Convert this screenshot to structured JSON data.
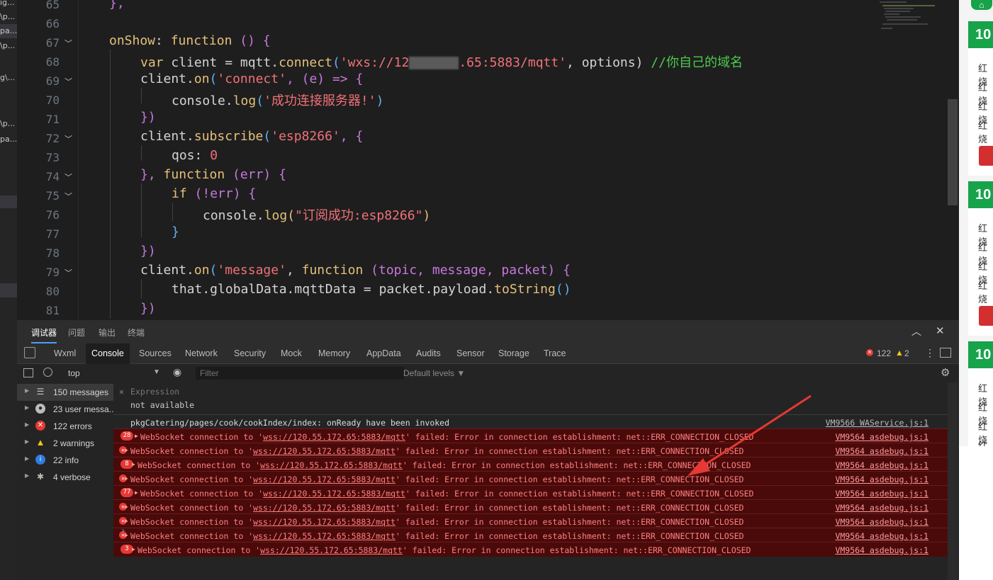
{
  "file_tree": {
    "items": [
      "ig...",
      "\\p...",
      "pa...",
      "\\p...",
      "g\\...",
      "\\p...",
      "pa..."
    ]
  },
  "editor": {
    "lines": [
      {
        "num": "65",
        "html_key": "l65"
      },
      {
        "num": "66"
      },
      {
        "num": "67"
      },
      {
        "num": "68"
      },
      {
        "num": "69"
      },
      {
        "num": "70"
      },
      {
        "num": "71"
      },
      {
        "num": "72"
      },
      {
        "num": "73"
      },
      {
        "num": "74"
      },
      {
        "num": "75"
      },
      {
        "num": "76"
      },
      {
        "num": "77"
      },
      {
        "num": "78"
      },
      {
        "num": "79"
      },
      {
        "num": "80"
      },
      {
        "num": "81"
      }
    ],
    "code": {
      "l65": "},",
      "l67_a": "onShow",
      "l67_b": ": ",
      "l67_c": "function",
      "l67_d": " () {",
      "l68_a": "var",
      "l68_b": " client = mqtt.",
      "l68_c": "connect",
      "l68_d": "(",
      "l68_e": "'wxs://12",
      "l68_f": ".65:5883/mqtt'",
      "l68_g": ", options) ",
      "l68_h": "//你自己的域名",
      "l69_a": "client.",
      "l69_b": "on",
      "l69_c": "(",
      "l69_d": "'connect'",
      "l69_e": ", (e) => {",
      "l70_a": "console.",
      "l70_b": "log",
      "l70_c": "(",
      "l70_d": "'成功连接服务器!'",
      "l70_e": ")",
      "l71": "})",
      "l72_a": "client.",
      "l72_b": "subscribe",
      "l72_c": "(",
      "l72_d": "'esp8266'",
      "l72_e": ", {",
      "l73_a": "qos: ",
      "l73_b": "0",
      "l74_a": "}, ",
      "l74_b": "function",
      "l74_c": " (err) {",
      "l75_a": "if",
      "l75_b": " (!err) {",
      "l76_a": "console.",
      "l76_b": "log",
      "l76_c": "(",
      "l76_d": "\"订阅成功:esp8266\"",
      "l76_e": ")",
      "l77": "}",
      "l78": "})",
      "l79_a": "client.",
      "l79_b": "on",
      "l79_c": "(",
      "l79_d": "'message'",
      "l79_e": ", ",
      "l79_f": "function",
      "l79_g": " (topic, message, packet) {",
      "l80_a": "that.globalData.mqttData = packet.payload.",
      "l80_b": "toString",
      "l80_c": "()",
      "l81": "})"
    }
  },
  "preview": {
    "home_icon": "home-icon",
    "cards": [
      {
        "head": "10",
        "rows": [
          "红烧",
          "红烧",
          "红烧",
          "红烧"
        ]
      },
      {
        "head": "10",
        "rows": [
          "红烧",
          "红烧",
          "红烧",
          "红烧"
        ]
      },
      {
        "head": "10",
        "rows": [
          "红烧",
          "红烧",
          "红烧",
          "红烧"
        ]
      }
    ]
  },
  "devtools": {
    "top_tabs": [
      "调试器",
      "问题",
      "输出",
      "终端"
    ],
    "tabs": [
      "Wxml",
      "Console",
      "Sources",
      "Network",
      "Security",
      "Mock",
      "Memory",
      "AppData",
      "Audits",
      "Sensor",
      "Storage",
      "Trace"
    ],
    "error_count": "122",
    "warning_count": "2",
    "context": "top",
    "filter_placeholder": "Filter",
    "levels": "Default levels ▼",
    "sidebar": [
      {
        "label": "150 messages",
        "icon": "list-icon"
      },
      {
        "label": "23 user messa...",
        "icon": "user-icon"
      },
      {
        "label": "122 errors",
        "icon": "error-icon"
      },
      {
        "label": "2 warnings",
        "icon": "warning-icon"
      },
      {
        "label": "22 info",
        "icon": "info-icon"
      },
      {
        "label": "4 verbose",
        "icon": "bug-icon"
      }
    ],
    "expression": {
      "label": "Expression",
      "value": "not available"
    },
    "info_log": {
      "text": "pkgCatering/pages/cook/cookIndex/index: onReady have been invoked",
      "src": "VM9566 WAService.js:1"
    },
    "errors": [
      {
        "badge": "28",
        "url": "wss://120.55.172.65:5883/mqtt",
        "src": "VM9564 asdebug.js:1"
      },
      {
        "badge": "",
        "url": "wss://120.55.172.65:5883/mqtt",
        "src": "VM9564 asdebug.js:1"
      },
      {
        "badge": "8",
        "url": "wss://120.55.172.65:5883/mqtt",
        "src": "VM9564 asdebug.js:1"
      },
      {
        "badge": "",
        "url": "wss://120.55.172.65:5883/mqtt",
        "src": "VM9564 asdebug.js:1"
      },
      {
        "badge": "77",
        "url": "wss://120.55.172.65:5883/mqtt",
        "src": "VM9564 asdebug.js:1"
      },
      {
        "badge": "",
        "url": "wss://120.55.172.65:5883/mqtt",
        "src": "VM9564 asdebug.js:1"
      },
      {
        "badge": "",
        "url": "wss://120.55.172.65:5883/mqtt",
        "src": "VM9564 asdebug.js:1"
      },
      {
        "badge": "",
        "url": "wss://120.55.172.65:5883/mqtt",
        "src": "VM9564 asdebug.js:1"
      },
      {
        "badge": "3",
        "url": "wss://120.55.172.65:5883/mqtt",
        "src": "VM9564 asdebug.js:1"
      }
    ],
    "err_prefix": "WebSocket connection to '",
    "err_suffix": "' failed: Error in connection establishment: net::ERR_CONNECTION_CLOSED",
    "prompt": "›"
  },
  "colors": {
    "accent": "#4d9cff",
    "error_bg": "#4a0a0a",
    "preview_green": "#17a34a",
    "arrow": "#e53935"
  }
}
